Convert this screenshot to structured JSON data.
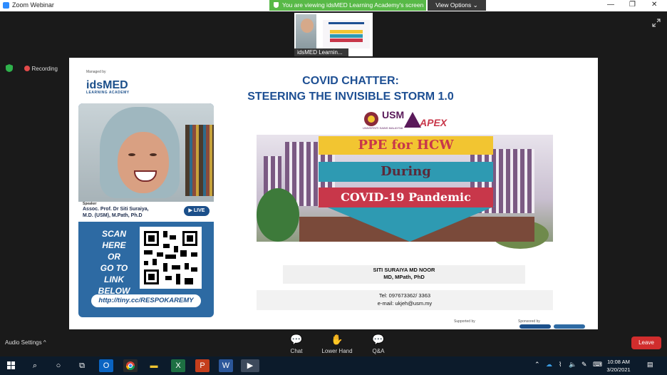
{
  "window": {
    "title": "Zoom Webinar",
    "minimize": "—",
    "restore": "❐",
    "close": "✕"
  },
  "banner": {
    "viewing_text": "You are viewing idsMED Learning Academy's screen",
    "view_options": "View Options ⌄"
  },
  "thumbnail": {
    "label": "idsMED Learnin..."
  },
  "status": {
    "recording": "Recording"
  },
  "slide": {
    "managed_by": "Managed by",
    "logo_text": "idsMED",
    "logo_sub": "LEARNING ACADEMY",
    "title_line1": "COVID CHATTER:",
    "title_line2": "STEERING THE INVISIBLE STORM 1.0",
    "usm_text": "USM",
    "usm_sub": "UNIVERSITI SAINS MALAYSIA",
    "apex_text": "APEX",
    "ribbon1": "PPE for HCW",
    "ribbon2": "During",
    "ribbon3": "COVID-19 Pandemic",
    "speaker_heading": "Speaker",
    "speaker_name": "Assoc. Prof. Dr Siti Suraiya,",
    "speaker_creds": "M.D. (USM), M.Path, Ph.D",
    "live": "LIVE",
    "scan_text": [
      "SCAN",
      "HERE",
      "OR",
      "GO TO",
      "LINK",
      "BELOW"
    ],
    "link": "http://tiny.cc/RESPOKAREMY",
    "presenter_name": "SITI SURAIYA MD NOOR",
    "presenter_creds": "MD, MPath, PhD",
    "tel": "Tel: 097673362/ 3363",
    "email": "e-mail: ukjeh@usm.my",
    "supported_by": "Supported by",
    "sponsored_by": "Sponsored by"
  },
  "controls": {
    "audio_settings": "Audio Settings ^",
    "chat": "Chat",
    "lower_hand": "Lower Hand",
    "qa": "Q&A",
    "leave": "Leave"
  },
  "taskbar": {
    "time": "10:08 AM",
    "date": "3/20/2021"
  },
  "colors": {
    "zoom_green": "#58b947",
    "leave_red": "#d12d2d",
    "title_blue": "#1d4f93",
    "ribbon_yellow": "#f2c531",
    "ribbon_teal": "#2e9ab2",
    "ribbon_red": "#c8374a"
  }
}
